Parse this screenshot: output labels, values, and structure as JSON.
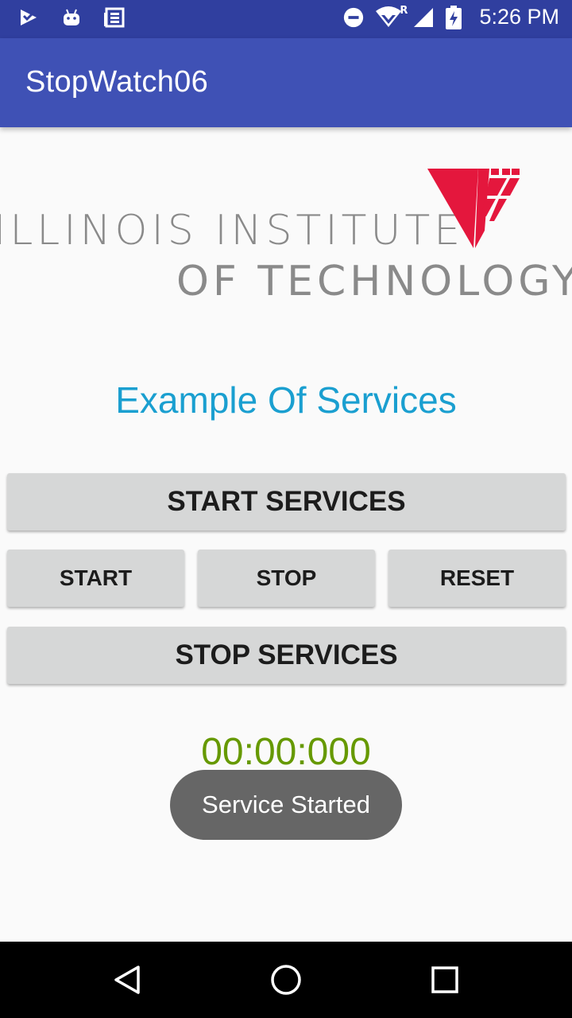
{
  "status_bar": {
    "left_icons": [
      "play-store-icon",
      "android-icon",
      "news-icon"
    ],
    "right_icons": [
      "do-not-disturb-icon",
      "wifi-icon",
      "signal-icon",
      "battery-icon"
    ],
    "roaming_label": "R",
    "time": "5:26 PM"
  },
  "app_bar": {
    "title": "StopWatch06"
  },
  "logo": {
    "line1": "ILLINOIS INSTITUTE",
    "line2": "OF TECHNOLOGY",
    "accent_color": "#e4173d"
  },
  "main": {
    "heading": "Example Of Services",
    "start_services_label": "START SERVICES",
    "start_label": "START",
    "stop_label": "STOP",
    "reset_label": "RESET",
    "stop_services_label": "STOP SERVICES",
    "timer": "00:00:000"
  },
  "toast": {
    "message": "Service Started"
  },
  "nav_bar": {
    "icons": [
      "back-icon",
      "home-icon",
      "recents-icon"
    ]
  },
  "colors": {
    "status_bar": "#303f9f",
    "app_bar": "#3f51b5",
    "heading": "#1a9fd0",
    "timer": "#669900",
    "button": "#d6d7d7"
  }
}
